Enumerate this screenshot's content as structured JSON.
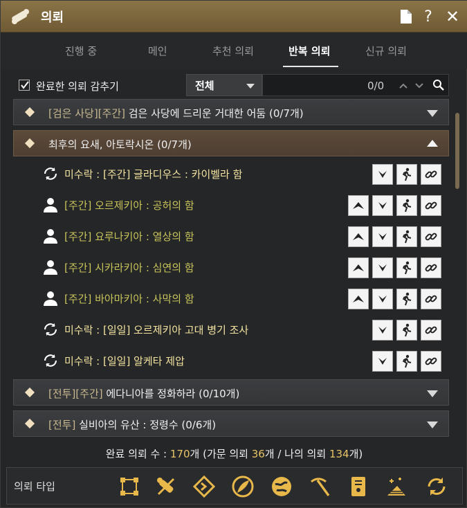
{
  "window": {
    "title": "의뢰"
  },
  "tabs": [
    {
      "label": "진행 중"
    },
    {
      "label": "메인"
    },
    {
      "label": "추천 의뢰"
    },
    {
      "label": "반복 의뢰"
    },
    {
      "label": "신규 의뢰"
    }
  ],
  "filter": {
    "hide_completed_label": "완료한 의뢰 감추기",
    "hide_completed_checked": true,
    "select_value": "전체",
    "count": "0/0"
  },
  "groups": [
    {
      "tag": "[검은 사당][주간]",
      "title": " 검은 사당에 드리운 거대한 어둠 (0/7개)",
      "open": false
    },
    {
      "tag": "",
      "title": "최후의 요새, 아토락시온 (0/7개)",
      "open": true
    },
    {
      "tag": "[전투][주간]",
      "title": " 에다니아를 정화하라 (0/10개)",
      "open": false
    },
    {
      "tag": "[전투]",
      "title": " 실비아의 유산 : 정령수 (0/6개)",
      "open": false
    }
  ],
  "quests": [
    {
      "icon": "repeat-icon",
      "text": "미수락 : [주간] 글라디우스 : 카이벨라 함",
      "color": "yellow",
      "buttons": [
        "down",
        "walk",
        "link"
      ]
    },
    {
      "icon": "person-icon",
      "text": "[주간] 오르제키아 : 공허의 함",
      "color": "green",
      "buttons": [
        "up",
        "down",
        "walk",
        "link"
      ]
    },
    {
      "icon": "person-icon",
      "text": "[주간] 요루나키아 : 열상의 함",
      "color": "green",
      "buttons": [
        "up",
        "down",
        "walk",
        "link"
      ]
    },
    {
      "icon": "person-icon",
      "text": "[주간] 시카라키아 : 심연의 함",
      "color": "green",
      "buttons": [
        "up",
        "down",
        "walk",
        "link"
      ]
    },
    {
      "icon": "person-icon",
      "text": "[주간] 바아마키아 : 사막의 함",
      "color": "green",
      "buttons": [
        "up",
        "down",
        "walk",
        "link"
      ]
    },
    {
      "icon": "repeat-icon",
      "text": "미수락 : [일일] 오르제키아 고대 병기 조사",
      "color": "yellow",
      "buttons": [
        "down",
        "walk",
        "link"
      ]
    },
    {
      "icon": "repeat-icon",
      "text": "미수락 : [일일] 알케타 제압",
      "color": "yellow",
      "buttons": [
        "down",
        "walk",
        "link"
      ]
    }
  ],
  "summary": {
    "prefix": "완료 의뢰 수 : ",
    "total": "170",
    "mid1": "개 (가문 의뢰 ",
    "family": "36",
    "mid2": "개 / 나의 의뢰 ",
    "mine": "134",
    "suffix": "개)"
  },
  "typebar": {
    "label": "의뢰 타입",
    "icons": [
      "nodes-icon",
      "scroll-tools-icon",
      "diamond-arrow-icon",
      "feather-icon",
      "globe-icon",
      "pickaxe-icon",
      "book-icon",
      "sparkle-hill-icon",
      "cycle-icon"
    ]
  },
  "colors": {
    "accent": "#e8c468",
    "titlebar": "#7a6640",
    "yellow_text": "#f4e4a0",
    "green_text": "#c8c45a"
  }
}
